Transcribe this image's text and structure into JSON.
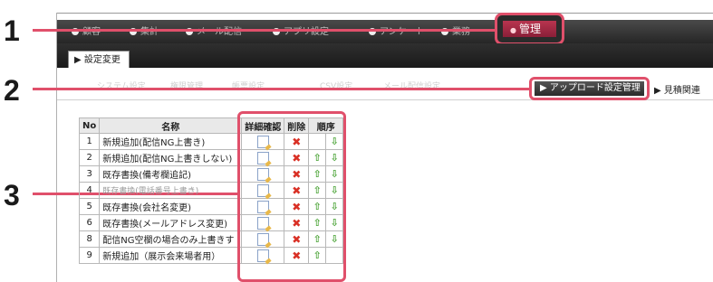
{
  "callouts": [
    "1",
    "2",
    "3"
  ],
  "nav": {
    "items": [
      "顧客",
      "集計",
      "メール配信",
      "アプリ設定",
      "アンケート",
      "業務"
    ],
    "active_label": "管理"
  },
  "subnav": {
    "tab_label": "▶ 設定変更"
  },
  "submenu": {
    "hidden_items": [
      "システム設定",
      "権限管理",
      "帳票設定",
      "CSV設定",
      "メール配信設定"
    ],
    "upload_label": "▶ アップロード設定管理",
    "estimate_label": "▶ 見積関連"
  },
  "table": {
    "headers": {
      "no": "No",
      "name": "名称",
      "detail": "詳細確認",
      "delete": "削除",
      "order": "順序"
    },
    "rows": [
      {
        "no": "1",
        "name": "新規追加(配信NG上書き)",
        "up": false,
        "down": true
      },
      {
        "no": "2",
        "name": "新規追加(配信NG上書きしない)",
        "up": true,
        "down": true
      },
      {
        "no": "3",
        "name": "既存書換(備考欄追記)",
        "up": true,
        "down": true
      },
      {
        "no": "4",
        "name": "既存書換(電話番号上書き)",
        "up": true,
        "down": true
      },
      {
        "no": "5",
        "name": "既存書換(会社名変更)",
        "up": true,
        "down": true
      },
      {
        "no": "6",
        "name": "既存書換(メールアドレス変更)",
        "up": true,
        "down": true
      },
      {
        "no": "8",
        "name": "配信NG空欄の場合のみ上書きす",
        "up": true,
        "down": true
      },
      {
        "no": "9",
        "name": "新規追加（展示会来場者用）",
        "up": true,
        "down": false
      }
    ]
  },
  "colors": {
    "highlight": "#e0506b",
    "nav_active": "#b8344f",
    "delete": "#d93025",
    "arrow": "#4aa336"
  }
}
